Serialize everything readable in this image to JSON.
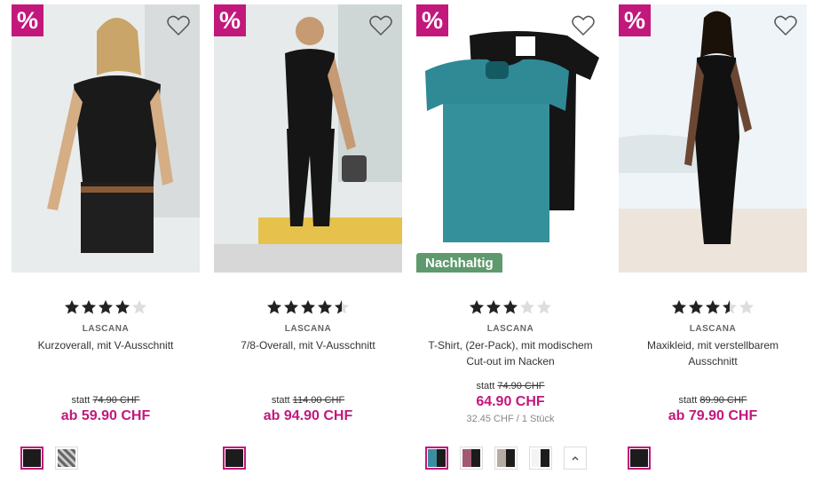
{
  "colors": {
    "sale": "#c2187c",
    "eco": "#5e9a6d",
    "price": "#c2187c"
  },
  "products": [
    {
      "sale_symbol": "%",
      "rating": 4,
      "brand": "LASCANA",
      "name": "Kurzoverall, mit V-Ausschnitt",
      "statt_label": "statt",
      "old_price": "74.90 CHF",
      "price": "ab 59.90 CHF",
      "swatches": [
        "black",
        "pattern-grey"
      ]
    },
    {
      "sale_symbol": "%",
      "rating": 4.5,
      "brand": "LASCANA",
      "name": "7/8-Overall, mit V-Ausschnitt",
      "statt_label": "statt",
      "old_price": "114.00 CHF",
      "price": "ab 94.90 CHF",
      "swatches": [
        "black"
      ]
    },
    {
      "sale_symbol": "%",
      "eco_badge": "Nachhaltig",
      "rating": 3,
      "brand": "LASCANA",
      "name": "T-Shirt, (2er-Pack), mit modischem Cut-out im Nacken",
      "statt_label": "statt",
      "old_price": "74.90 CHF",
      "price": "64.90 CHF",
      "unit_price": "32.45 CHF / 1 Stück",
      "swatches": [
        "teal-black",
        "berry-black",
        "taupe-black",
        "white-black"
      ],
      "more_icon": "chevron-up-icon"
    },
    {
      "sale_symbol": "%",
      "rating": 3.5,
      "brand": "LASCANA",
      "name": "Maxikleid, mit verstellbarem Ausschnitt",
      "statt_label": "statt",
      "old_price": "89.90 CHF",
      "price": "ab 79.90 CHF",
      "swatches": [
        "black"
      ]
    }
  ]
}
